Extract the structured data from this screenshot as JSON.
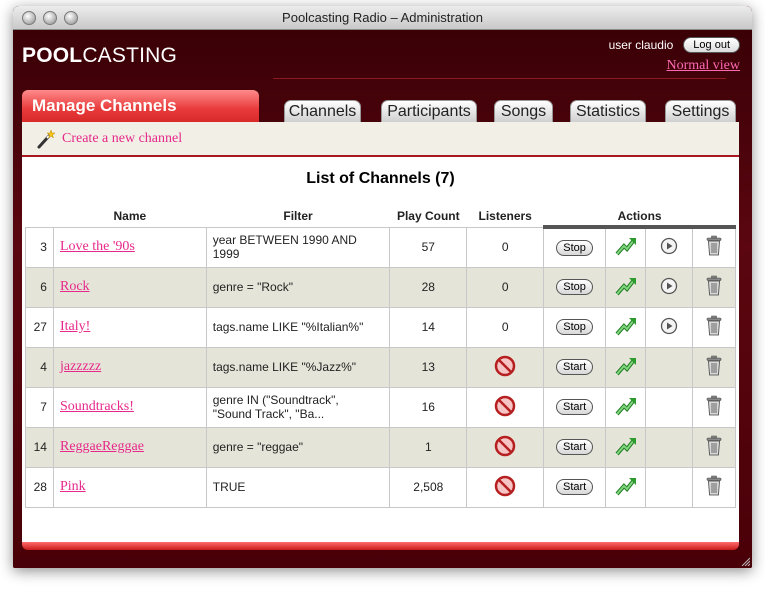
{
  "window": {
    "title": "Poolcasting Radio – Administration"
  },
  "header": {
    "logo_bold": "POOL",
    "logo_rest": "CASTING",
    "user": "user claudio",
    "logout": "Log out",
    "normal_view": "Normal view"
  },
  "section": {
    "title": "Manage Channels"
  },
  "tabs": [
    "Channels",
    "Participants",
    "Songs",
    "Statistics",
    "Settings"
  ],
  "create_link": "Create a new channel",
  "list_title": "List of Channels (7)",
  "columns": {
    "name": "Name",
    "filter": "Filter",
    "play_count": "Play Count",
    "listeners": "Listeners",
    "actions": "Actions"
  },
  "rows": [
    {
      "id": "3",
      "name": "Love the '90s",
      "filter_1": "year BETWEEN 1990 AND",
      "filter_2": "1999",
      "play_count": "57",
      "listeners": "0",
      "action": "Stop"
    },
    {
      "id": "6",
      "name": "Rock",
      "filter_1": "genre = \"Rock\"",
      "filter_2": "",
      "play_count": "28",
      "listeners": "0",
      "action": "Stop"
    },
    {
      "id": "27",
      "name": "Italy!",
      "filter_1": "tags.name LIKE \"%Italian%\"",
      "filter_2": "",
      "play_count": "14",
      "listeners": "0",
      "action": "Stop"
    },
    {
      "id": "4",
      "name": "jazzzzz",
      "filter_1": "tags.name LIKE \"%Jazz%\"",
      "filter_2": "",
      "play_count": "13",
      "listeners": "",
      "action": "Start"
    },
    {
      "id": "7",
      "name": "Soundtracks!",
      "filter_1": "genre IN (\"Soundtrack\",",
      "filter_2": "\"Sound Track\", \"Ba...",
      "play_count": "16",
      "listeners": "",
      "action": "Start"
    },
    {
      "id": "14",
      "name": "ReggaeReggae",
      "filter_1": "genre = \"reggae\"",
      "filter_2": "",
      "play_count": "1",
      "listeners": "",
      "action": "Start"
    },
    {
      "id": "28",
      "name": "Pink",
      "filter_1": "TRUE",
      "filter_2": "",
      "play_count": "2,508",
      "listeners": "",
      "action": "Start"
    }
  ]
}
